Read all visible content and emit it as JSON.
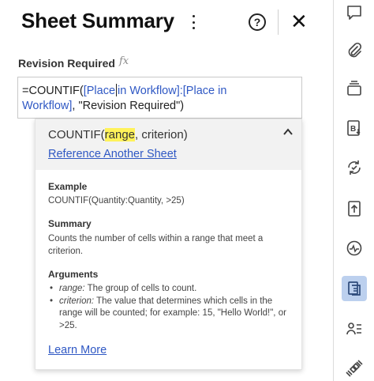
{
  "panel": {
    "title": "Sheet Summary",
    "help_glyph": "?",
    "close_glyph": "✕"
  },
  "field": {
    "label": "Revision Required",
    "fx_glyph": "fx",
    "formula": {
      "prefix": "=COUNTIF(",
      "ref1_part1": "[Place",
      "ref1_part2": "in Workflow]:[Place in",
      "ref1_part3": "Workflow]",
      "suffix": ", \"Revision Required\")"
    }
  },
  "popup": {
    "signature_name": "COUNTIF(",
    "signature_param": "range",
    "signature_rest": ", criterion)",
    "reference_link": "Reference Another Sheet",
    "example_heading": "Example",
    "example_text": "COUNTIF(Quantity:Quantity, >25)",
    "summary_heading": "Summary",
    "summary_text": "Counts the number of cells within a range that meet a criterion.",
    "arguments_heading": "Arguments",
    "arguments": [
      {
        "name": "range:",
        "desc": " The group of cells to count."
      },
      {
        "name": "criterion:",
        "desc": " The value that determines which cells in the range will be counted; for example: 15, \"Hello World!\", or >25."
      }
    ],
    "learn_more": "Learn More"
  },
  "rail": {
    "icons": [
      "comment-icon",
      "attachment-icon",
      "proofing-icon",
      "form-icon",
      "activity-log-icon",
      "upload-icon",
      "activity-icon",
      "sheet-summary-icon",
      "people-icon",
      "connector-icon"
    ],
    "active": "sheet-summary-icon",
    "active_color": "#bcd0ee"
  }
}
